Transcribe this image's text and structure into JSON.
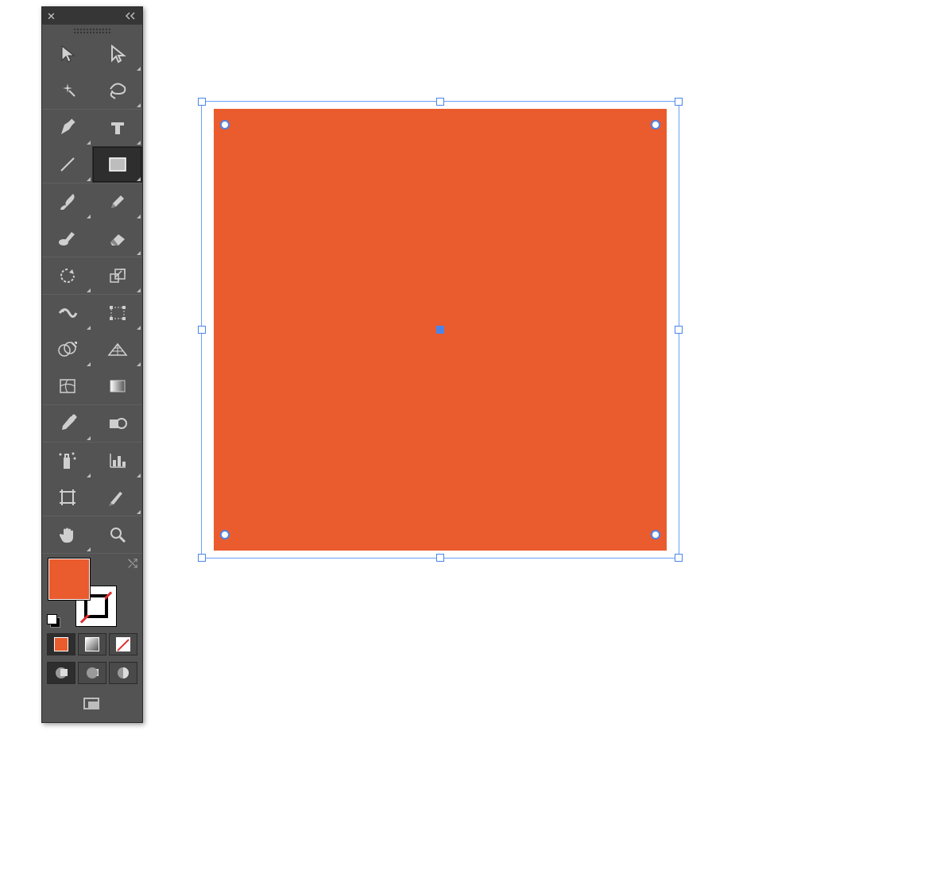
{
  "panel": {
    "close_tooltip": "Close",
    "collapse_tooltip": "Collapse"
  },
  "tools": [
    {
      "name": "selection-tool",
      "flyout": false
    },
    {
      "name": "direct-selection-tool",
      "flyout": true
    },
    {
      "name": "magic-wand-tool",
      "flyout": false
    },
    {
      "name": "lasso-tool",
      "flyout": true
    },
    {
      "name": "pen-tool",
      "flyout": true
    },
    {
      "name": "type-tool",
      "flyout": true
    },
    {
      "name": "line-segment-tool",
      "flyout": true
    },
    {
      "name": "rectangle-tool",
      "flyout": true,
      "selected": true
    },
    {
      "name": "paintbrush-tool",
      "flyout": true
    },
    {
      "name": "pencil-tool",
      "flyout": true
    },
    {
      "name": "blob-brush-tool",
      "flyout": false
    },
    {
      "name": "eraser-tool",
      "flyout": true
    },
    {
      "name": "rotate-tool",
      "flyout": true
    },
    {
      "name": "scale-tool",
      "flyout": true
    },
    {
      "name": "width-tool",
      "flyout": true
    },
    {
      "name": "free-transform-tool",
      "flyout": true
    },
    {
      "name": "shape-builder-tool",
      "flyout": true
    },
    {
      "name": "perspective-grid-tool",
      "flyout": true
    },
    {
      "name": "mesh-tool",
      "flyout": false
    },
    {
      "name": "gradient-tool",
      "flyout": false
    },
    {
      "name": "eyedropper-tool",
      "flyout": true
    },
    {
      "name": "blend-tool",
      "flyout": false
    },
    {
      "name": "symbol-sprayer-tool",
      "flyout": true
    },
    {
      "name": "column-graph-tool",
      "flyout": true
    },
    {
      "name": "artboard-tool",
      "flyout": false
    },
    {
      "name": "slice-tool",
      "flyout": true
    },
    {
      "name": "hand-tool",
      "flyout": true
    },
    {
      "name": "zoom-tool",
      "flyout": false
    }
  ],
  "separators_after": [
    3,
    7,
    11,
    13,
    19,
    21,
    25,
    27
  ],
  "colors": {
    "fill": "#ea5b2e",
    "stroke": "none",
    "selection": "#4b85e8"
  },
  "fill_modes": [
    {
      "name": "color-mode",
      "active": true
    },
    {
      "name": "gradient-mode",
      "active": false
    },
    {
      "name": "none-mode",
      "active": false
    }
  ],
  "draw_modes": [
    {
      "name": "draw-normal",
      "active": true
    },
    {
      "name": "draw-behind",
      "active": false
    },
    {
      "name": "draw-inside",
      "active": false
    }
  ],
  "shape": {
    "type": "rectangle",
    "selected": true,
    "corner_widgets": true
  }
}
